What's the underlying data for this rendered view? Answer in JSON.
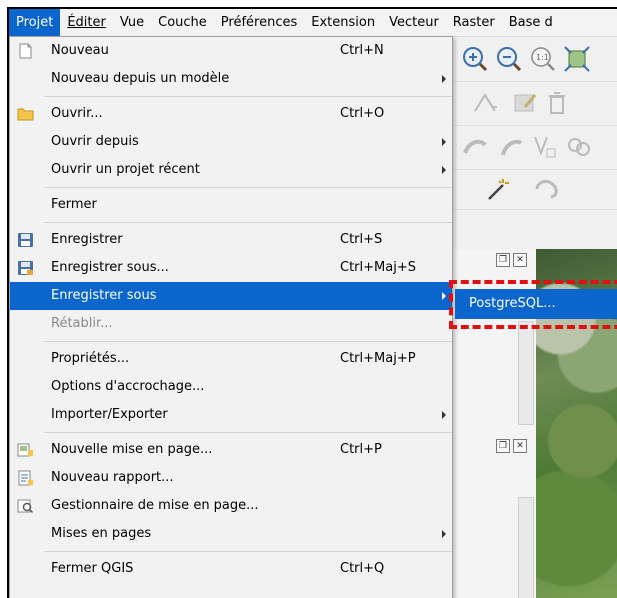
{
  "menubar": {
    "items": [
      {
        "label": "Projet",
        "active": true
      },
      {
        "label": "Éditer"
      },
      {
        "label": "Vue"
      },
      {
        "label": "Couche"
      },
      {
        "label": "Préférences"
      },
      {
        "label": "Extension"
      },
      {
        "label": "Vecteur"
      },
      {
        "label": "Raster"
      },
      {
        "label": "Base d"
      }
    ]
  },
  "projet_menu": {
    "nouveau": {
      "label": "Nouveau",
      "shortcut": "Ctrl+N",
      "icon": "new-file-icon"
    },
    "nouveau_modele": {
      "label": "Nouveau depuis un modèle"
    },
    "ouvrir": {
      "label": "Ouvrir...",
      "shortcut": "Ctrl+O",
      "icon": "folder-icon"
    },
    "ouvrir_depuis": {
      "label": "Ouvrir depuis"
    },
    "ouvrir_recent": {
      "label": "Ouvrir un projet récent"
    },
    "fermer": {
      "label": "Fermer"
    },
    "enregistrer": {
      "label": "Enregistrer",
      "shortcut": "Ctrl+S",
      "icon": "save-icon"
    },
    "enregistrer_sous_dlg": {
      "label": "Enregistrer sous...",
      "shortcut": "Ctrl+Maj+S",
      "icon": "save-as-icon"
    },
    "enregistrer_sous": {
      "label": "Enregistrer sous"
    },
    "retablir": {
      "label": "Rétablir..."
    },
    "proprietes": {
      "label": "Propriétés...",
      "shortcut": "Ctrl+Maj+P"
    },
    "options_accrochage": {
      "label": "Options d'accrochage..."
    },
    "importer_exporter": {
      "label": "Importer/Exporter"
    },
    "nouvelle_mise_en_page": {
      "label": "Nouvelle mise en page...",
      "shortcut": "Ctrl+P",
      "icon": "new-layout-icon"
    },
    "nouveau_rapport": {
      "label": "Nouveau rapport...",
      "icon": "new-report-icon"
    },
    "gestionnaire": {
      "label": "Gestionnaire de mise en page...",
      "icon": "layout-manager-icon"
    },
    "mises_en_pages": {
      "label": "Mises en pages"
    },
    "fermer_qgis": {
      "label": "Fermer QGIS",
      "shortcut": "Ctrl+Q"
    }
  },
  "submenu": {
    "postgresql": "PostgreSQL..."
  },
  "colors": {
    "highlight": "#0a66cc",
    "annotation": "#e01010"
  }
}
